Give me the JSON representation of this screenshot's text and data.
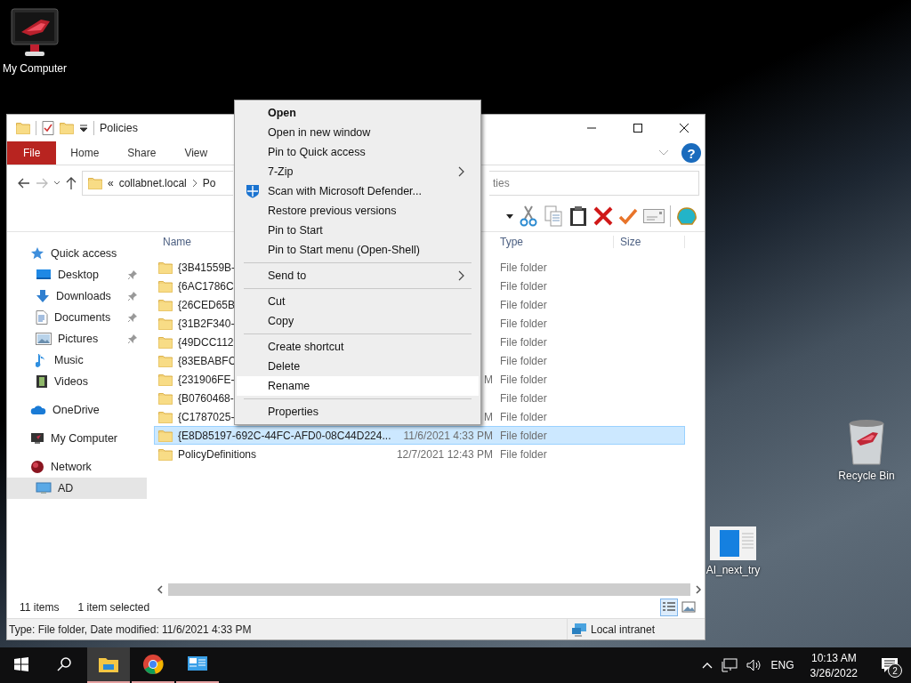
{
  "desktop_icons": [
    {
      "label": "My Computer"
    },
    {
      "label": "Recycle Bin"
    },
    {
      "label": "AI_next_try"
    }
  ],
  "window": {
    "title": "Policies"
  },
  "ribbon": {
    "tabs": [
      {
        "label": "File",
        "selected": true
      },
      {
        "label": "Home",
        "selected": false
      },
      {
        "label": "Share",
        "selected": false
      },
      {
        "label": "View",
        "selected": false
      }
    ],
    "help": "?"
  },
  "address": {
    "overflow": "«",
    "crumbs": [
      "collabnet.local",
      "Po"
    ]
  },
  "search": {
    "placeholder": "ties"
  },
  "sidebar": {
    "items": [
      {
        "label": "Quick access",
        "selected": false,
        "children": [
          {
            "label": "Desktop",
            "pinned": true,
            "selected": false
          },
          {
            "label": "Downloads",
            "pinned": true,
            "selected": false
          },
          {
            "label": "Documents",
            "pinned": true,
            "selected": false
          },
          {
            "label": "Pictures",
            "pinned": true,
            "selected": false
          },
          {
            "label": "Music",
            "pinned": false,
            "selected": false
          },
          {
            "label": "Videos",
            "pinned": false,
            "selected": false
          }
        ]
      },
      {
        "label": "OneDrive",
        "selected": false
      },
      {
        "label": "My Computer",
        "selected": false
      },
      {
        "label": "Network",
        "selected": false,
        "children": [
          {
            "label": "AD",
            "pinned": false,
            "selected": true
          }
        ]
      }
    ]
  },
  "columns": [
    {
      "label": "Name"
    },
    {
      "label": "Type"
    },
    {
      "label": "Size"
    }
  ],
  "files": [
    {
      "name": "{3B41559B-",
      "type": "File folder",
      "selected": false
    },
    {
      "name": "{6AC1786C",
      "type": "File folder",
      "selected": false
    },
    {
      "name": "{26CED65B",
      "type": "File folder",
      "selected": false
    },
    {
      "name": "{31B2F340-",
      "type": "File folder",
      "selected": false
    },
    {
      "name": "{49DCC112",
      "type": "File folder",
      "selected": false
    },
    {
      "name": "{83EBABFC",
      "type": "File folder",
      "selected": false
    },
    {
      "name": "{231906FE-",
      "date": "M",
      "type": "File folder",
      "selected": false
    },
    {
      "name": "{B0760468-",
      "type": "File folder",
      "selected": false
    },
    {
      "name": "{C1787025-",
      "date": "M",
      "type": "File folder",
      "selected": false
    },
    {
      "name": "{E8D85197-692C-44FC-AFD0-08C44D224...",
      "date": "11/6/2021 4:33 PM",
      "type": "File folder",
      "selected": true
    },
    {
      "name": "PolicyDefinitions",
      "date": "12/7/2021 12:43 PM",
      "type": "File folder",
      "selected": false
    }
  ],
  "status": {
    "count": "11 items",
    "selection": "1 item selected",
    "views": [
      {
        "kind": "details",
        "selected": true
      },
      {
        "kind": "large-icons",
        "selected": false
      }
    ]
  },
  "status_bar": {
    "details": "Type: File folder, Date modified: 11/6/2021 4:33 PM",
    "zone": "Local intranet"
  },
  "context_menu": {
    "items": [
      {
        "kind": "item",
        "label": "Open",
        "default": true,
        "selected": false
      },
      {
        "kind": "item",
        "label": "Open in new window",
        "default": false,
        "selected": false
      },
      {
        "kind": "item",
        "label": "Pin to Quick access",
        "default": false,
        "selected": false
      },
      {
        "kind": "submenu",
        "label": "7-Zip",
        "default": false,
        "selected": false
      },
      {
        "kind": "item",
        "label": "Scan with Microsoft Defender...",
        "default": false,
        "selected": false
      },
      {
        "kind": "item",
        "label": "Restore previous versions",
        "default": false,
        "selected": false
      },
      {
        "kind": "item",
        "label": "Pin to Start",
        "default": false,
        "selected": false
      },
      {
        "kind": "item",
        "label": "Pin to Start menu (Open-Shell)",
        "default": false,
        "selected": false
      },
      {
        "kind": "separator"
      },
      {
        "kind": "submenu",
        "label": "Send to",
        "default": false,
        "selected": false
      },
      {
        "kind": "separator"
      },
      {
        "kind": "item",
        "label": "Cut",
        "default": false,
        "selected": false
      },
      {
        "kind": "item",
        "label": "Copy",
        "default": false,
        "selected": false
      },
      {
        "kind": "separator"
      },
      {
        "kind": "item",
        "label": "Create shortcut",
        "default": false,
        "selected": false
      },
      {
        "kind": "item",
        "label": "Delete",
        "default": false,
        "selected": false
      },
      {
        "kind": "item",
        "label": "Rename",
        "default": false,
        "selected": true
      },
      {
        "kind": "separator"
      },
      {
        "kind": "item",
        "label": "Properties",
        "default": false,
        "selected": false
      }
    ]
  },
  "taskbar": {
    "apps": [
      {
        "kind": "explorer",
        "active": true
      },
      {
        "kind": "chrome",
        "active": false
      },
      {
        "kind": "remote-desktop",
        "active": false
      }
    ],
    "language": "ENG",
    "time": "10:13 AM",
    "date": "3/26/2022",
    "notifications": "2"
  }
}
